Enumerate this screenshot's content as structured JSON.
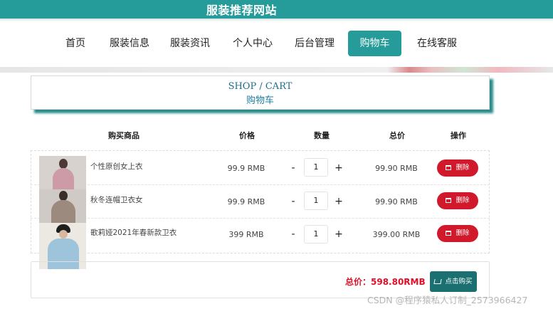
{
  "site": {
    "title": "服装推荐网站"
  },
  "nav": {
    "items": [
      {
        "label": "首页"
      },
      {
        "label": "服装信息"
      },
      {
        "label": "服装资讯"
      },
      {
        "label": "个人中心"
      },
      {
        "label": "后台管理"
      },
      {
        "label": "购物车",
        "active": true
      },
      {
        "label": "在线客服"
      }
    ]
  },
  "cart_header": {
    "en": "SHOP / CART",
    "zh": "购物车"
  },
  "columns": [
    "购买商品",
    "价格",
    "数量",
    "总价",
    "操作"
  ],
  "products": [
    {
      "name": "个性原创女上衣",
      "price": "99.9 RMB",
      "qty": "1",
      "subtotal": "99.90 RMB",
      "qty_minus": "-",
      "qty_plus": "+",
      "delete_label": "删除"
    },
    {
      "name": "秋冬连帽卫衣女",
      "price": "99.9 RMB",
      "qty": "1",
      "subtotal": "99.90 RMB",
      "qty_minus": "-",
      "qty_plus": "+",
      "delete_label": "删除"
    },
    {
      "name": "歌莉娅2021年春新款卫衣",
      "price": "399 RMB",
      "qty": "1",
      "subtotal": "399.00 RMB",
      "qty_minus": "-",
      "qty_plus": "+",
      "delete_label": "删除"
    }
  ],
  "summary": {
    "total_text": "总价：598.80RMB",
    "buy_label": "点击购买"
  },
  "watermark": "CSDN @程序猿私人订制_2573966427",
  "colors": {
    "brand": "#259b9a",
    "delete": "#d0192a",
    "buy": "#1a6f70",
    "total": "#e0102a"
  },
  "icons": {
    "delete": "trash-icon",
    "buy": "cart-icon"
  }
}
